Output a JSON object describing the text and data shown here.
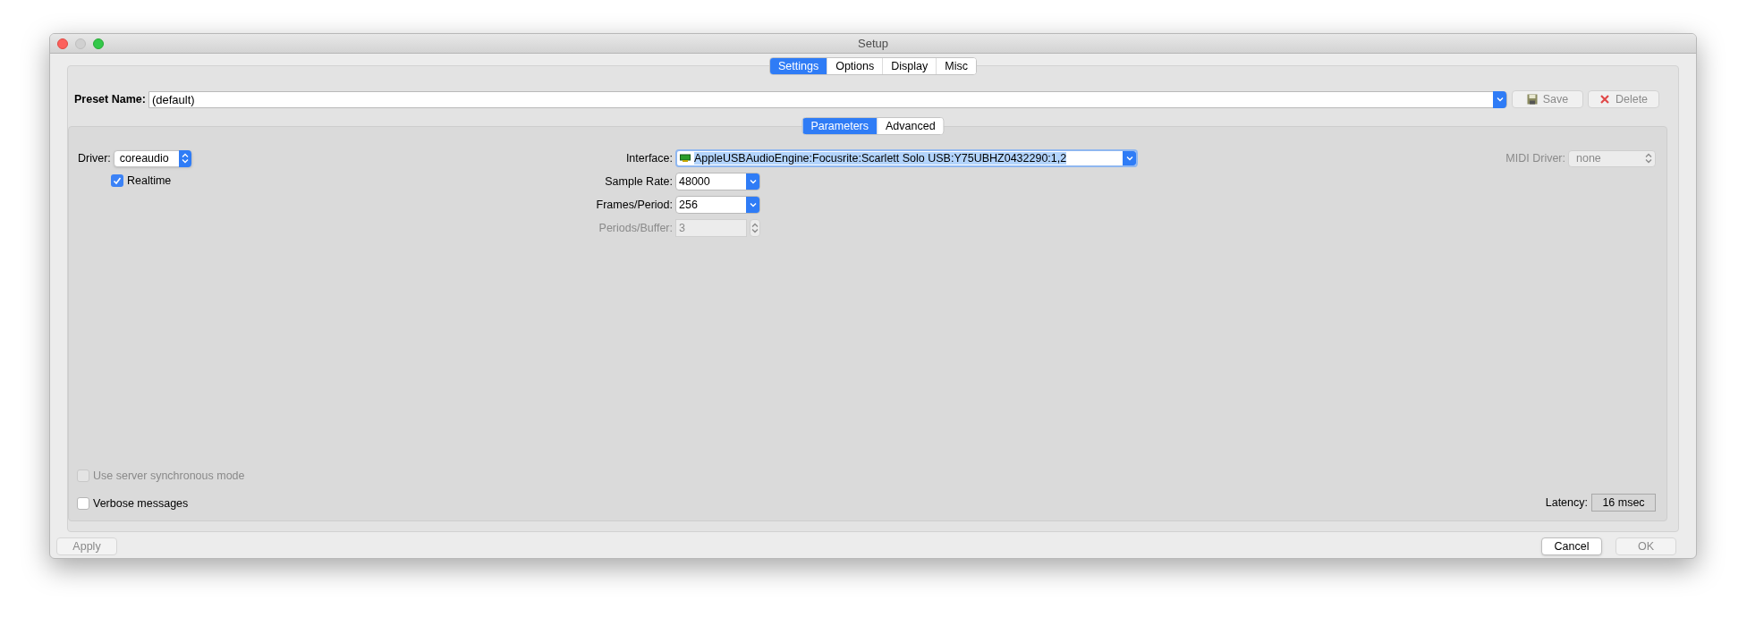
{
  "window": {
    "title": "Setup"
  },
  "tabs": [
    {
      "label": "Settings",
      "selected": true
    },
    {
      "label": "Options",
      "selected": false
    },
    {
      "label": "Display",
      "selected": false
    },
    {
      "label": "Misc",
      "selected": false
    }
  ],
  "preset": {
    "label": "Preset Name:",
    "value": "(default)"
  },
  "preset_buttons": [
    {
      "kind": "save",
      "label": "Save",
      "disabled": true
    },
    {
      "kind": "delete",
      "label": "Delete",
      "disabled": true
    }
  ],
  "subtabs": [
    {
      "label": "Parameters",
      "selected": true
    },
    {
      "label": "Advanced",
      "selected": false
    }
  ],
  "driver": {
    "label": "Driver:",
    "value": "coreaudio"
  },
  "realtime": {
    "label": "Realtime",
    "checked": true,
    "disabled": false
  },
  "interface": {
    "label": "Interface:",
    "value": "AppleUSBAudioEngine:Focusrite:Scarlett Solo USB:Y75UBHZ0432290:1,2",
    "text_selected": true
  },
  "audio_fields": [
    {
      "kind": "combo",
      "label": "Sample Rate:",
      "value": "48000",
      "disabled": false
    },
    {
      "kind": "combo",
      "label": "Frames/Period:",
      "value": "256",
      "disabled": false
    },
    {
      "kind": "spin",
      "label": "Periods/Buffer:",
      "value": "3",
      "disabled": true
    }
  ],
  "midi_driver": {
    "label": "MIDI Driver:",
    "value": "none",
    "disabled": true
  },
  "options": [
    {
      "label": "Use server synchronous mode",
      "checked": false,
      "disabled": true
    },
    {
      "label": "Verbose messages",
      "checked": false,
      "disabled": false
    }
  ],
  "latency": {
    "label": "Latency:",
    "value": "16 msec"
  },
  "footer_buttons": [
    {
      "label": "Apply",
      "disabled": true
    },
    {
      "label": "Cancel",
      "disabled": false
    },
    {
      "label": "OK",
      "disabled": true
    }
  ]
}
